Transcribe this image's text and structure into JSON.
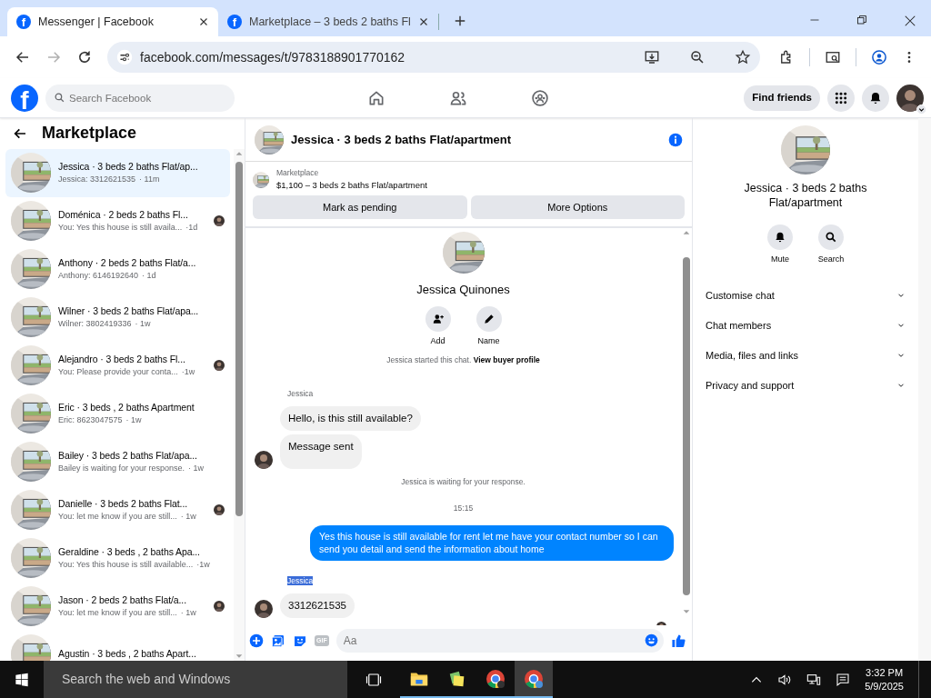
{
  "browser": {
    "tabs": [
      {
        "favicon": "f",
        "title": "Messenger | Facebook",
        "selected": true
      },
      {
        "favicon": "f",
        "title": "Marketplace – 3 beds 2 baths Fl",
        "selected": false
      }
    ],
    "url": "facebook.com/messages/t/9783188901770162"
  },
  "facebook_bar": {
    "logo": "f",
    "search_placeholder": "Search Facebook",
    "find_friends": "Find friends"
  },
  "sidebar": {
    "title": "Marketplace",
    "conversations": [
      {
        "title": "Jessica · 3 beds 2 baths Flat/ap...",
        "preview": "Jessica: 3312621535",
        "time": "· 11m",
        "selected": true,
        "seen": false
      },
      {
        "title": "Doménica · 2 beds 2 baths Fl...",
        "preview": "You: Yes this house is still availa...",
        "time": "·1d",
        "selected": false,
        "seen": true
      },
      {
        "title": "Anthony · 2 beds 2 baths Flat/a...",
        "preview": "Anthony: 6146192640",
        "time": "· 1d",
        "selected": false,
        "seen": false
      },
      {
        "title": "Wilner · 3 beds 2 baths Flat/apa...",
        "preview": "Wilner: 3802419336",
        "time": "· 1w",
        "selected": false,
        "seen": false
      },
      {
        "title": "Alejandro · 3 beds 2 baths Fl...",
        "preview": "You: Please provide your conta...",
        "time": "·1w",
        "selected": false,
        "seen": true
      },
      {
        "title": "Eric · 3 beds , 2 baths Apartment",
        "preview": "Eric: 8623047575",
        "time": "· 1w",
        "selected": false,
        "seen": false
      },
      {
        "title": "Bailey · 3 beds 2 baths Flat/apa...",
        "preview": "Bailey is waiting for your response.",
        "time": "· 1w",
        "selected": false,
        "seen": false
      },
      {
        "title": "Danielle · 3 beds 2 baths Flat...",
        "preview": "You: let me know if you are still...",
        "time": "· 1w",
        "selected": false,
        "seen": true
      },
      {
        "title": "Geraldine · 3 beds , 2 baths Apa...",
        "preview": "You: Yes this house is still available...",
        "time": "·1w",
        "selected": false,
        "seen": false
      },
      {
        "title": "Jason · 2 beds 2 baths Flat/a...",
        "preview": "You: let me know if you are still...",
        "time": "· 1w",
        "selected": false,
        "seen": true
      },
      {
        "title": "Agustin · 3 beds , 2 baths Apart..."
      }
    ]
  },
  "chat": {
    "title": "Jessica · 3 beds 2 baths Flat/apartment",
    "listing": {
      "source": "Marketplace",
      "summary": "$1,100 – 3 beds 2 baths Flat/apartment"
    },
    "buttons": [
      "Mark as pending",
      "More Options"
    ],
    "profile_name": "Jessica Quinones",
    "profile_actions": [
      {
        "kind": "add",
        "label": "Add"
      },
      {
        "kind": "name",
        "label": "Name"
      }
    ],
    "messages": [
      {
        "kind": "system",
        "text": "Jessica started this chat.",
        "link": "View buyer profile"
      },
      {
        "kind": "sender",
        "text": "Jessica",
        "highlighted": false
      },
      {
        "kind": "incoming",
        "text": "Hello, is this still available?",
        "avatar": false
      },
      {
        "kind": "incoming",
        "text": "Message sent",
        "avatar": true
      },
      {
        "kind": "system",
        "text": "Jessica is waiting for your response."
      },
      {
        "kind": "time",
        "text": "15:15"
      },
      {
        "kind": "outgoing",
        "text": "Yes this house is still available for rent let me have your contact number so I can send you detail and send the information about home"
      },
      {
        "kind": "sender",
        "text": "Jessica",
        "highlighted": true
      },
      {
        "kind": "incoming",
        "text": "3312621535",
        "avatar": true
      },
      {
        "kind": "seen"
      }
    ],
    "composer": {
      "placeholder": "Aa",
      "gif": "GIF"
    }
  },
  "details": {
    "title": "Jessica · 3 beds 2 baths Flat/apartment",
    "actions": [
      {
        "kind": "mute",
        "label": "Mute"
      },
      {
        "kind": "search",
        "label": "Search"
      }
    ],
    "sections": [
      "Customise chat",
      "Chat members",
      "Media, files and links",
      "Privacy and support"
    ]
  },
  "taskbar": {
    "search_placeholder": "Search the web and Windows",
    "time": "3:32 PM",
    "date": "5/9/2025"
  }
}
